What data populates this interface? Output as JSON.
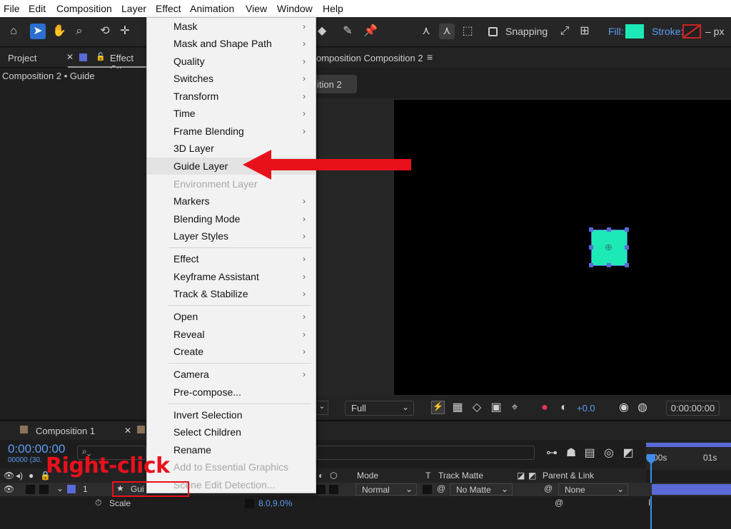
{
  "menubar": {
    "items": [
      "File",
      "Edit",
      "Composition",
      "Layer",
      "Effect",
      "Animation",
      "View",
      "Window",
      "Help"
    ]
  },
  "toolbar": {
    "snapping_label": "Snapping",
    "fill_label": "Fill:",
    "stroke_label": "Stroke:",
    "stroke_suffix": "– px",
    "fill_color": "#1de9b6"
  },
  "project_panel": {
    "tab_project": "Project",
    "tab_effect": "Effect Co",
    "subtitle": "Composition 2 • Guide"
  },
  "comp_panel": {
    "tab_title": "omposition Composition 2",
    "sub_tab": "ition 2"
  },
  "viewer_bar": {
    "resolution": "Full",
    "exposure": "+0.0",
    "timecode": "0:00:00:00"
  },
  "context_menu": {
    "items": [
      {
        "label": "Mask",
        "submenu": true
      },
      {
        "label": "Mask and Shape Path",
        "submenu": true
      },
      {
        "label": "Quality",
        "submenu": true
      },
      {
        "label": "Switches",
        "submenu": true
      },
      {
        "label": "Transform",
        "submenu": true
      },
      {
        "label": "Time",
        "submenu": true
      },
      {
        "label": "Frame Blending",
        "submenu": true
      },
      {
        "label": "3D Layer",
        "submenu": false
      },
      {
        "label": "Guide Layer",
        "submenu": false
      },
      {
        "label": "Environment Layer",
        "submenu": false,
        "disabled": true
      },
      {
        "label": "Markers",
        "submenu": true
      },
      {
        "label": "Blending Mode",
        "submenu": true
      },
      {
        "label": "Layer Styles",
        "submenu": true
      },
      {
        "label": "Effect",
        "submenu": true
      },
      {
        "label": "Keyframe Assistant",
        "submenu": true
      },
      {
        "label": "Track & Stabilize",
        "submenu": true
      },
      {
        "label": "Open",
        "submenu": true
      },
      {
        "label": "Reveal",
        "submenu": true
      },
      {
        "label": "Create",
        "submenu": true
      },
      {
        "label": "Camera",
        "submenu": true
      },
      {
        "label": "Pre-compose...",
        "submenu": false
      },
      {
        "label": "Invert Selection",
        "submenu": false
      },
      {
        "label": "Select Children",
        "submenu": false
      },
      {
        "label": "Rename",
        "submenu": false
      },
      {
        "label": "Add to Essential Graphics",
        "submenu": false,
        "disabled": true
      },
      {
        "label": "Scene Edit Detection...",
        "submenu": false,
        "disabled": true
      }
    ]
  },
  "timeline": {
    "tab_label": "Composition 1",
    "timecode": "0:00:00:00",
    "frames": "00000 (30.",
    "columns": {
      "mode": "Mode",
      "t": "T",
      "track_matte": "Track Matte",
      "parent_link": "Parent & Link"
    },
    "layer": {
      "index": "1",
      "name": "Gui",
      "mode": "Normal",
      "track_matte": "No Matte",
      "parent": "None"
    },
    "property": {
      "name": "Scale",
      "value": "8.0,9.0%"
    },
    "ruler": {
      "start": "0:00s",
      "mark": "01s"
    }
  },
  "annotations": {
    "right_click_label": "Right-click",
    "arrow_color": "#e8111b"
  }
}
